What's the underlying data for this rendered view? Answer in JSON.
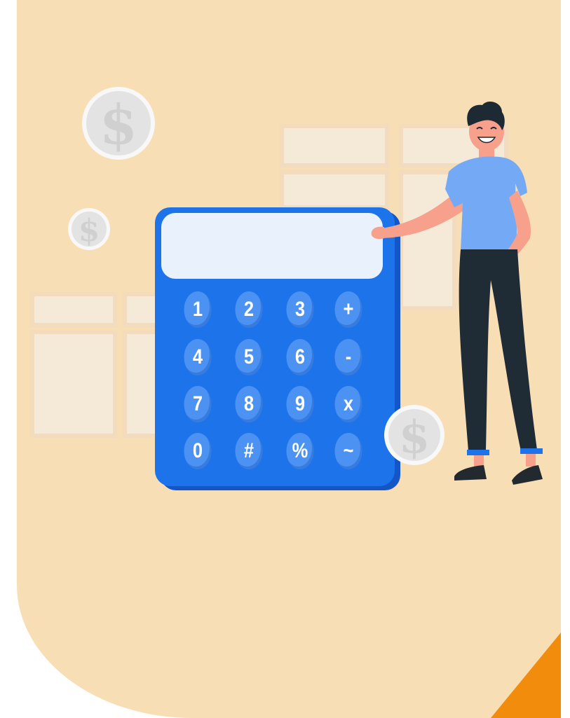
{
  "palette": {
    "panel": "#f8deb5",
    "table_cell": "#f5ead8",
    "table_frame": "#f6e2c6",
    "coin": "#e6e6e6",
    "coin_ring": "#f8f8f8",
    "calculator_body": "#1d74ea",
    "calculator_edge": "#1456c8",
    "key": "#4b92f2",
    "screen": "#e9f1fd",
    "shirt": "#74a9f5",
    "pants": "#1f2c36",
    "hair": "#1d2a33",
    "skin": "#f7a08c",
    "accent_corner": "#f28c0c"
  },
  "calculator": {
    "keys": [
      [
        "1",
        "2",
        "3",
        "+"
      ],
      [
        "4",
        "5",
        "6",
        "-"
      ],
      [
        "7",
        "8",
        "9",
        "x"
      ],
      [
        "0",
        "#",
        "%",
        "~"
      ]
    ]
  },
  "icons": {
    "coin": "dollar-coin-icon",
    "person": "smiling-man-illustration"
  }
}
